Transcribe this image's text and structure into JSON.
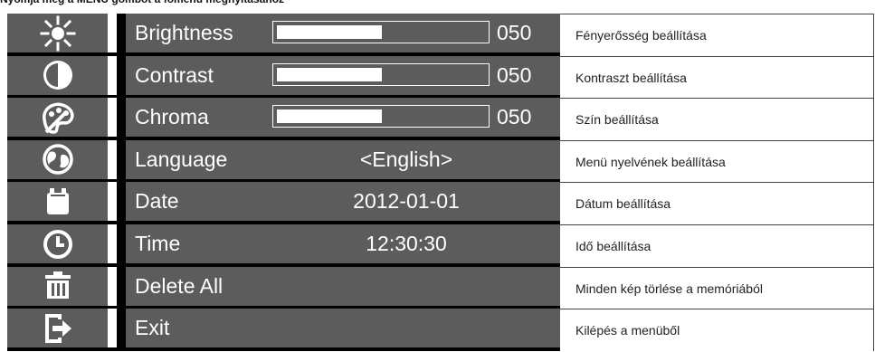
{
  "caption": "Nyomja meg a MENU gombot a főmenü megnyitásához",
  "menu": [
    {
      "icon": "brightness-icon",
      "label": "Brightness",
      "type": "slider",
      "level": 0.5,
      "value": "050"
    },
    {
      "icon": "contrast-icon",
      "label": "Contrast",
      "type": "slider",
      "level": 0.5,
      "value": "050"
    },
    {
      "icon": "chroma-icon",
      "label": "Chroma",
      "type": "slider",
      "level": 0.5,
      "value": "050"
    },
    {
      "icon": "globe-icon",
      "label": "Language",
      "type": "value",
      "value": "<English>"
    },
    {
      "icon": "calendar-icon",
      "label": "Date",
      "type": "value",
      "value": "2012-01-01"
    },
    {
      "icon": "clock-icon",
      "label": "Time",
      "type": "value",
      "value": "12:30:30"
    },
    {
      "icon": "trash-icon",
      "label": "Delete All",
      "type": "none",
      "value": ""
    },
    {
      "icon": "exit-icon",
      "label": "Exit",
      "type": "none",
      "value": ""
    }
  ],
  "descriptions": [
    "Fényerősség beállítása",
    "Kontraszt beállítása",
    "Szín beállítása",
    "Menü nyelvének beállítása",
    "Dátum beállítása",
    "Idő beállítása",
    "Minden kép törlése a memóriából",
    "Kilépés a menüből"
  ],
  "colors": {
    "menu_bg": "#5c5c5c",
    "separator": "#000000",
    "text": "#ffffff"
  }
}
